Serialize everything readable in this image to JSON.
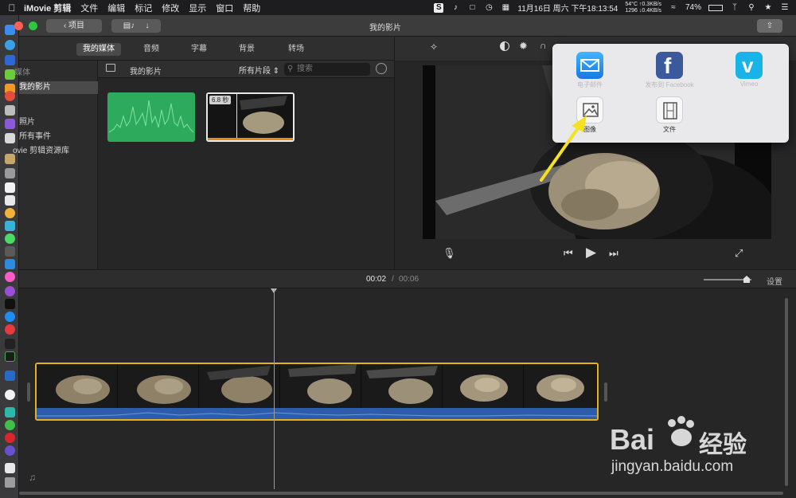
{
  "menubar": {
    "app_name": "iMovie 剪辑",
    "menus": [
      "文件",
      "编辑",
      "标记",
      "修改",
      "显示",
      "窗口",
      "帮助"
    ],
    "datetime": "11月16日 周六 下午18:13:54",
    "net_stats_line1": "54°C ↑0.3KB/s",
    "net_stats_line2": "1296 ↓0.4KB/s",
    "battery": "74%"
  },
  "titlebar": {
    "back_label": "项目",
    "window_title": "我的影片"
  },
  "tabs": [
    "我的媒体",
    "音频",
    "字幕",
    "背景",
    "转场"
  ],
  "active_tab": 0,
  "sidebar": {
    "items": [
      {
        "label": "媒体",
        "type": "head"
      },
      {
        "label": "我的影片",
        "type": "selected"
      },
      {
        "label": "照片",
        "type": "item"
      },
      {
        "label": "所有事件",
        "type": "item"
      },
      {
        "label": "ovie 剪辑资源库",
        "type": "item"
      }
    ]
  },
  "browser": {
    "title": "我的影片",
    "filter": "所有片段",
    "search_placeholder": "搜索",
    "clip_duration": "6.8 秒"
  },
  "share_popover": {
    "items": [
      {
        "label": "电子邮件",
        "icon": "mail-icon"
      },
      {
        "label": "发布到 Facebook",
        "icon": "facebook-icon"
      },
      {
        "label": "Vimeo",
        "icon": "vimeo-icon"
      },
      {
        "label": "图像",
        "icon": "image-icon"
      },
      {
        "label": "文件",
        "icon": "file-icon"
      }
    ]
  },
  "timeline": {
    "current_time": "00:02",
    "separator": "/",
    "total_time": "00:06",
    "settings_label": "设置"
  },
  "watermark": {
    "brand": "Bai",
    "brand_cn": "经验",
    "url": "jingyan.baidu.com"
  },
  "colors": {
    "accent_yellow": "#e6b21c",
    "audio_blue": "#2c5dac",
    "green_clip": "#2eaa5c",
    "annotation_arrow": "#f5e021"
  }
}
